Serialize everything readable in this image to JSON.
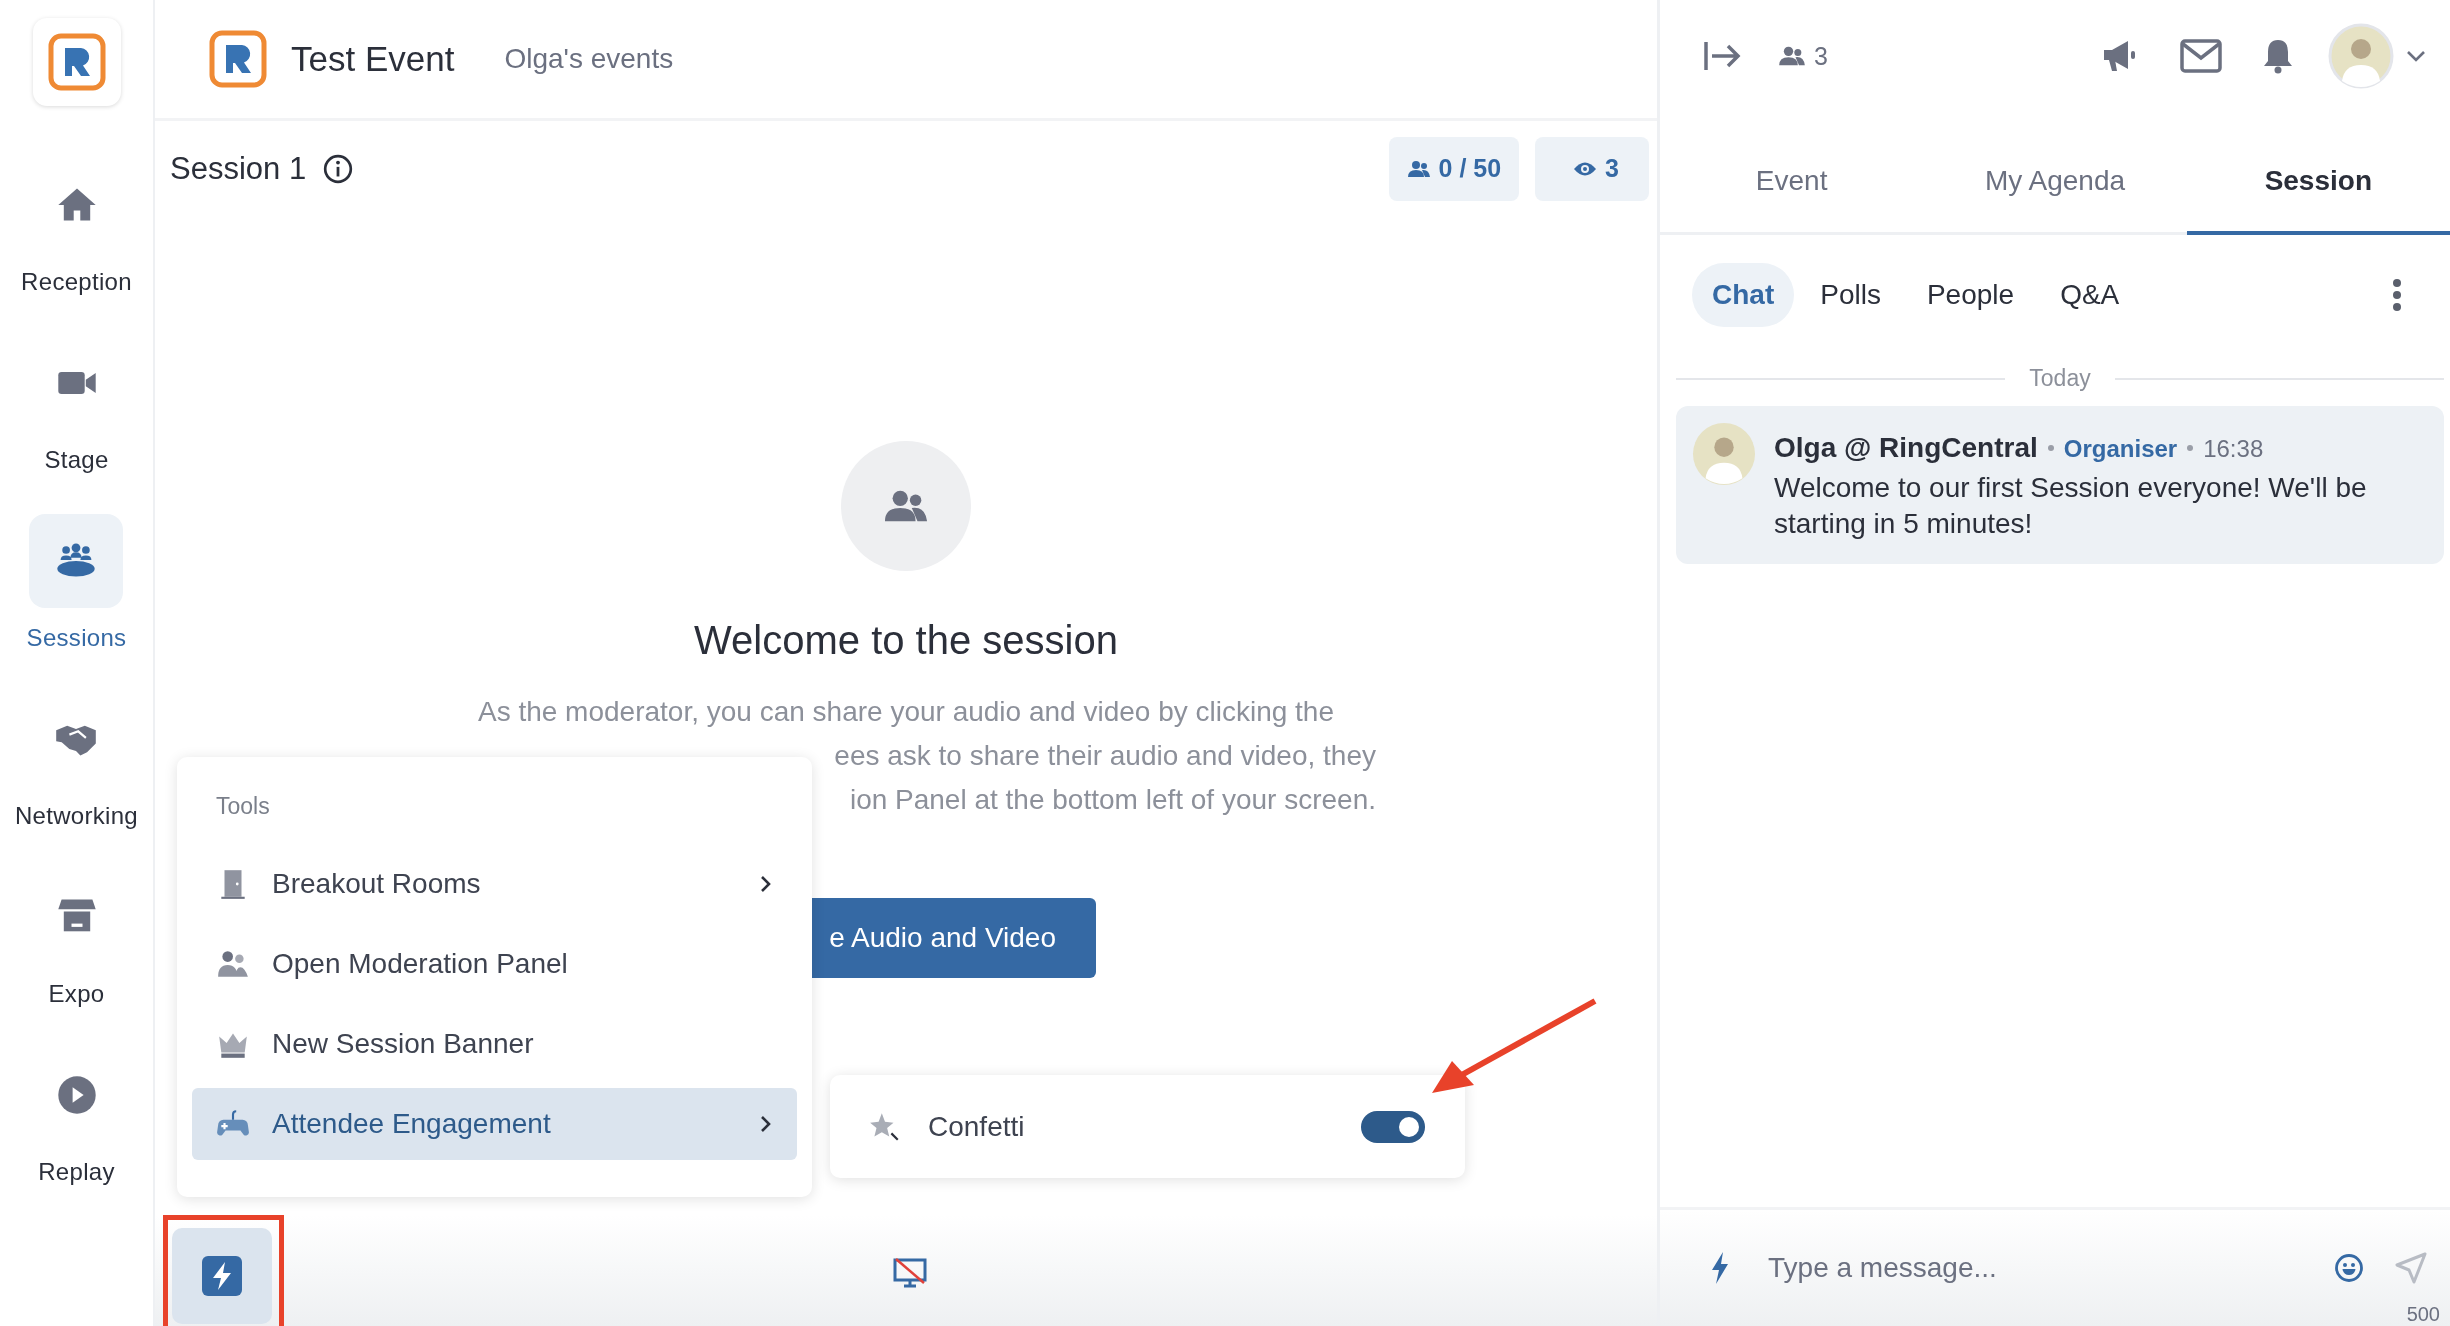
{
  "nav": [
    {
      "label": "Reception",
      "selected": false
    },
    {
      "label": "Stage",
      "selected": false
    },
    {
      "label": "Sessions",
      "selected": true
    },
    {
      "label": "Networking",
      "selected": false
    },
    {
      "label": "Expo",
      "selected": false
    },
    {
      "label": "Replay",
      "selected": false
    }
  ],
  "header": {
    "title": "Test Event",
    "subtitle": "Olga's events"
  },
  "session_bar": {
    "title": "Session 1",
    "capacity": "0 / 50",
    "viewers": "3"
  },
  "welcome": {
    "heading": "Welcome to the session",
    "lines": [
      "As the moderator, you can share your audio and video by clicking the",
      "ees ask to share their audio and video, they",
      "ion Panel at the bottom left of your screen."
    ],
    "button": "e Audio and Video"
  },
  "tools_menu": {
    "title": "Tools",
    "items": [
      {
        "label": "Breakout Rooms",
        "selected": false,
        "submenu": true
      },
      {
        "label": "Open Moderation Panel",
        "selected": false,
        "submenu": false
      },
      {
        "label": "New Session Banner",
        "selected": false,
        "submenu": false
      },
      {
        "label": "Attendee Engagement",
        "selected": true,
        "submenu": true
      }
    ]
  },
  "engagement_menu": {
    "items": [
      {
        "label": "Confetti",
        "on": true
      }
    ]
  },
  "right_panel": {
    "attendees": "3",
    "tabs": [
      {
        "label": "Event",
        "selected": false
      },
      {
        "label": "My Agenda",
        "selected": false
      },
      {
        "label": "Session",
        "selected": true
      }
    ],
    "subtabs": [
      {
        "label": "Chat",
        "selected": true
      },
      {
        "label": "Polls",
        "selected": false
      },
      {
        "label": "People",
        "selected": false
      },
      {
        "label": "Q&A",
        "selected": false
      }
    ],
    "date_divider": "Today",
    "messages": [
      {
        "author": "Olga @ RingCentral",
        "role": "Organiser",
        "time": "16:38",
        "text": "Welcome to our first Session everyone! We'll be starting in 5 minutes!"
      }
    ],
    "composer": {
      "placeholder": "Type a message...",
      "counter": "500"
    }
  }
}
